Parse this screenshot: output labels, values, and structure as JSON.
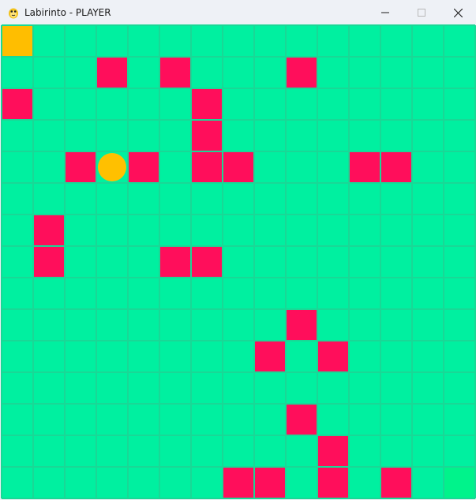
{
  "window": {
    "title": "Labirinto - PLAYER",
    "icon": "pygame-snake-icon",
    "controls": [
      "minimize-icon",
      "maximize-icon",
      "close-icon"
    ]
  },
  "maze": {
    "rows": 15,
    "cols": 15,
    "colors": {
      "floor": "#00f0a0",
      "grid_line": "#19d896",
      "wall": "#ff0e5b",
      "start": "#ffbe00",
      "goal": "#00f38b",
      "player": "#ffc000"
    },
    "start": [
      0,
      0
    ],
    "goal": [
      14,
      14
    ],
    "player": [
      4,
      3
    ],
    "walls": [
      [
        1,
        3
      ],
      [
        1,
        5
      ],
      [
        1,
        9
      ],
      [
        2,
        0
      ],
      [
        2,
        6
      ],
      [
        3,
        6
      ],
      [
        4,
        2
      ],
      [
        4,
        4
      ],
      [
        4,
        6
      ],
      [
        4,
        7
      ],
      [
        4,
        11
      ],
      [
        4,
        12
      ],
      [
        6,
        1
      ],
      [
        7,
        1
      ],
      [
        7,
        5
      ],
      [
        7,
        6
      ],
      [
        9,
        9
      ],
      [
        10,
        8
      ],
      [
        10,
        10
      ],
      [
        12,
        9
      ],
      [
        13,
        10
      ],
      [
        14,
        7
      ],
      [
        14,
        8
      ],
      [
        14,
        10
      ],
      [
        14,
        12
      ]
    ]
  }
}
